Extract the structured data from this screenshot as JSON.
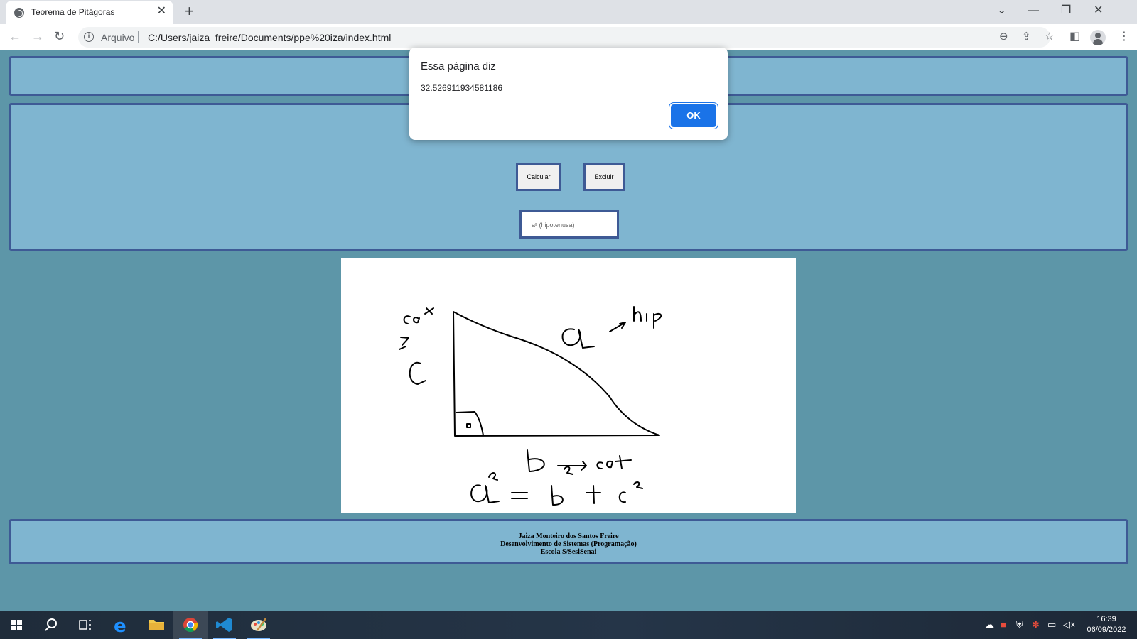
{
  "browser": {
    "tab_title": "Teorema de Pitágoras",
    "tab_close": "✕",
    "new_tab": "+",
    "window_controls": [
      "⌄",
      "—",
      "❐",
      "✕"
    ],
    "nav": {
      "back": "←",
      "forward": "→",
      "reload": "↻"
    },
    "address": {
      "scheme_label": "Arquivo",
      "url": "C:/Users/jaiza_freire/Documents/ppe%20iza/index.html"
    },
    "icons": [
      "zoom-out-icon",
      "share-icon",
      "star-icon",
      "side-panel-icon",
      "profile-icon",
      "menu-icon"
    ]
  },
  "page": {
    "inputs": [
      {
        "placeholder": ""
      },
      {
        "placeholder": ""
      }
    ],
    "buttons": {
      "calculate": "Calcular",
      "delete": "Excluir"
    },
    "result_placeholder": "a² (hipotenusa)",
    "drawing": {
      "description_icon": "hand-drawn-pythagorean-triangle"
    },
    "footer": {
      "lines": [
        "Jaiza Monteiro dos Santos Freire",
        "Desenvolvimento de Sistemas (Programação)",
        "Escola S/SesiSenai"
      ]
    }
  },
  "dialog": {
    "title": "Essa página diz",
    "message": "32.526911934581186",
    "ok_label": "OK"
  },
  "taskbar": {
    "apps": [
      "windows-start-icon",
      "search-icon",
      "task-view-icon",
      "edge-icon",
      "file-explorer-icon",
      "chrome-icon",
      "vscode-icon",
      "paint-icon"
    ],
    "tray_icons": [
      "network-drive-icon",
      "office-icon",
      "security-shield-icon",
      "people-icon",
      "network-icon",
      "volume-muted-icon"
    ],
    "time": "16:39",
    "date": "06/09/2022"
  },
  "colors": {
    "page_background": "#5d96a8",
    "panel_fill": "#7fb5d0",
    "panel_border": "#3e5a95",
    "dialog_button": "#1a73e8"
  }
}
